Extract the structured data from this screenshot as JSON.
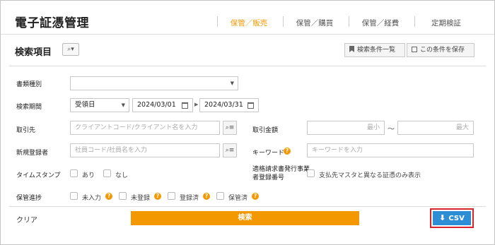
{
  "app": {
    "title": "電子証憑管理"
  },
  "tabs": [
    {
      "label": "保管／販売",
      "active": true
    },
    {
      "label": "保管／購買",
      "active": false
    },
    {
      "label": "保管／経費",
      "active": false
    },
    {
      "label": "定期検証",
      "active": false
    }
  ],
  "section": {
    "title": "検索項目",
    "filter_icon": "⌕▾",
    "save_list_label": "検索条件一覧",
    "save_current_label": "この条件を保存"
  },
  "fields": {
    "doc_type": {
      "label": "書類種別",
      "value": ""
    },
    "period": {
      "label": "検索期間",
      "type_value": "受領日",
      "from": "2024/03/01",
      "to": "2024/03/31"
    },
    "partner": {
      "label": "取引先",
      "placeholder": "クライアントコード/クライアント名を入力"
    },
    "amount": {
      "label": "取引金額",
      "min_placeholder": "最小",
      "max_placeholder": "最大",
      "tilde": "～"
    },
    "registrant": {
      "label": "新規登録者",
      "placeholder": "社員コード/社員名を入力"
    },
    "keyword": {
      "label": "キーワード",
      "placeholder": "キーワードを入力"
    },
    "timestamp": {
      "label": "タイムスタンプ",
      "options": [
        "あり",
        "なし"
      ]
    },
    "invoice": {
      "label_line1": "適格請求書発行事業",
      "label_line2": "者登録番号",
      "option": "支払先マスタと異なる証憑のみ表示"
    },
    "progress": {
      "label": "保管進捗",
      "options": [
        "未入力",
        "未登録",
        "登録済",
        "保管済"
      ]
    }
  },
  "footer": {
    "clear_label": "クリア",
    "search_label": "検索",
    "csv_label": "CSV"
  },
  "colors": {
    "accent": "#f39800",
    "csv_blue": "#2d8ed6",
    "highlight_red": "#d8252b"
  }
}
